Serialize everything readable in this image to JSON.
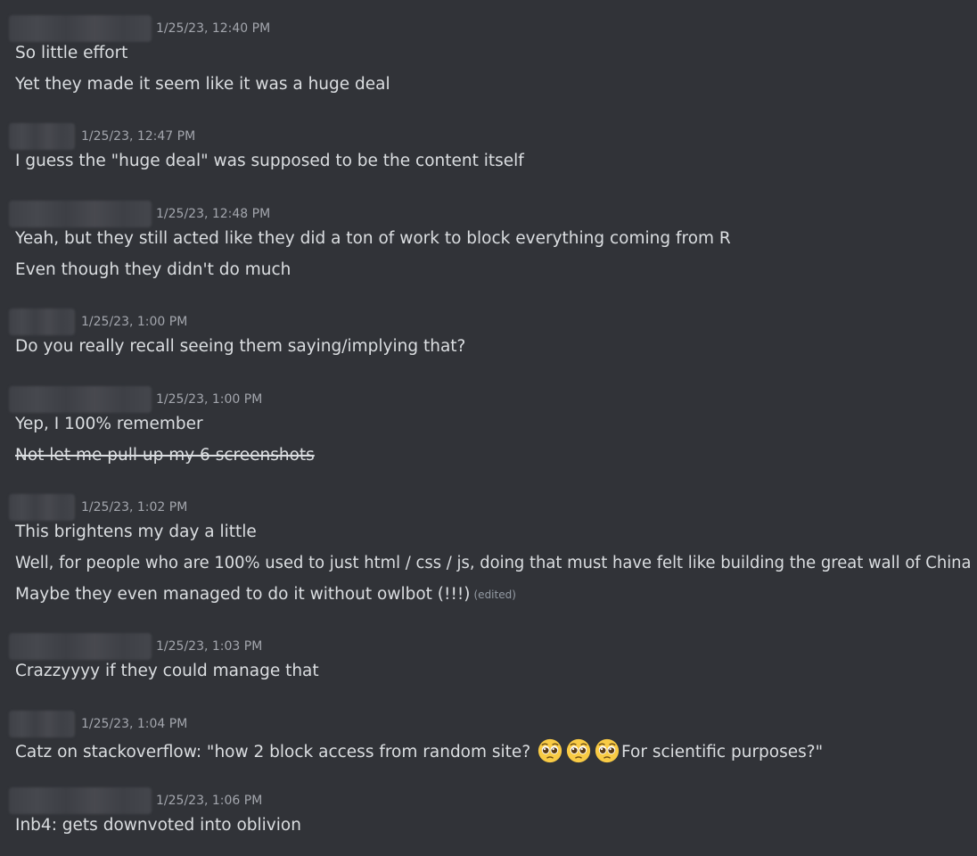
{
  "messages": [
    {
      "timestamp": "1/25/23, 12:40 PM",
      "lines": [
        {
          "text": "So little effort"
        },
        {
          "text": "Yet they made it seem like it was a huge deal"
        }
      ]
    },
    {
      "timestamp": "1/25/23, 12:47 PM",
      "lines": [
        {
          "text": "I guess the \"huge deal\" was supposed to be the content itself"
        }
      ]
    },
    {
      "timestamp": "1/25/23, 12:48 PM",
      "lines": [
        {
          "text": "Yeah, but they still acted like they did a ton of work to block everything coming from R"
        },
        {
          "text": "Even though they didn't do much"
        }
      ]
    },
    {
      "timestamp": "1/25/23, 1:00 PM",
      "lines": [
        {
          "text": "Do you really recall seeing them saying/implying that?"
        }
      ]
    },
    {
      "timestamp": "1/25/23, 1:00 PM",
      "lines": [
        {
          "text": "Yep, I 100% remember"
        },
        {
          "text": "Not let me pull up my 6 screenshots",
          "strikethrough": true
        }
      ]
    },
    {
      "timestamp": "1/25/23, 1:02 PM",
      "lines": [
        {
          "text": "This brightens my day a little"
        },
        {
          "text": "Well, for people who are 100% used to just html / css / js, doing that must have felt like building the great wall of China"
        },
        {
          "text": "Maybe they even managed to do it without owlbot (!!!)",
          "edited_label": "(edited)"
        }
      ]
    },
    {
      "timestamp": "1/25/23, 1:03 PM",
      "lines": [
        {
          "text": "Crazzyyyy if they could manage that"
        }
      ]
    },
    {
      "timestamp": "1/25/23, 1:04 PM",
      "lines": [
        {
          "text_before": "Catz on stackoverflow: \"how 2 block access from random site?",
          "emojis": [
            "pleading-face-emoji",
            "pleading-face-emoji",
            "pleading-face-emoji"
          ],
          "text_after": "For scientific purposes?\""
        }
      ]
    },
    {
      "timestamp": "1/25/23, 1:06 PM",
      "lines": [
        {
          "text": "Inb4: gets downvoted into oblivion"
        }
      ]
    }
  ],
  "colors": {
    "background": "#313338",
    "message_text": "#dbdee1",
    "timestamp_text": "#a3a6ad",
    "edited_text": "#949ba4"
  }
}
